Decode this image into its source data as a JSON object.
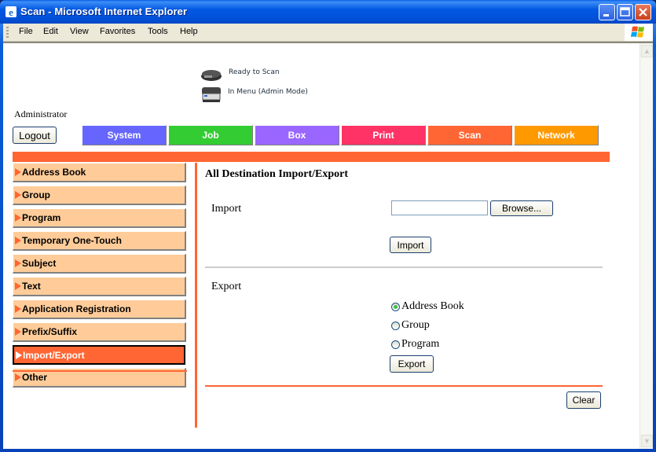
{
  "window": {
    "title": "Scan - Microsoft Internet Explorer",
    "controls": [
      "minimize",
      "maximize",
      "close"
    ]
  },
  "menubar": {
    "items": [
      "File",
      "Edit",
      "View",
      "Favorites",
      "Tools",
      "Help"
    ]
  },
  "status": {
    "line1": "Ready to Scan",
    "line2": "In Menu (Admin Mode)"
  },
  "user": {
    "role": "Administrator",
    "logout_label": "Logout"
  },
  "tabs": [
    {
      "label": "System",
      "color": "#6666ff"
    },
    {
      "label": "Job",
      "color": "#33cc33"
    },
    {
      "label": "Box",
      "color": "#9966ff"
    },
    {
      "label": "Print",
      "color": "#ff3366"
    },
    {
      "label": "Scan",
      "color": "#ff6633"
    },
    {
      "label": "Network",
      "color": "#ff9900"
    }
  ],
  "accent_color": "#ff6633",
  "sidebar": {
    "items": [
      {
        "label": "Address Book",
        "active": false
      },
      {
        "label": "Group",
        "active": false
      },
      {
        "label": "Program",
        "active": false
      },
      {
        "label": "Temporary One-Touch",
        "active": false
      },
      {
        "label": "Subject",
        "active": false
      },
      {
        "label": "Text",
        "active": false
      },
      {
        "label": "Application Registration",
        "active": false
      },
      {
        "label": "Prefix/Suffix",
        "active": false
      },
      {
        "label": "Import/Export",
        "active": true
      },
      {
        "label": "Other",
        "active": false
      }
    ]
  },
  "main": {
    "title": "All Destination Import/Export",
    "import": {
      "label": "Import",
      "file_value": "",
      "browse_label": "Browse...",
      "button_label": "Import"
    },
    "export": {
      "label": "Export",
      "options": [
        {
          "label": "Address Book",
          "checked": true
        },
        {
          "label": "Group",
          "checked": false
        },
        {
          "label": "Program",
          "checked": false
        }
      ],
      "button_label": "Export"
    },
    "clear_label": "Clear"
  }
}
